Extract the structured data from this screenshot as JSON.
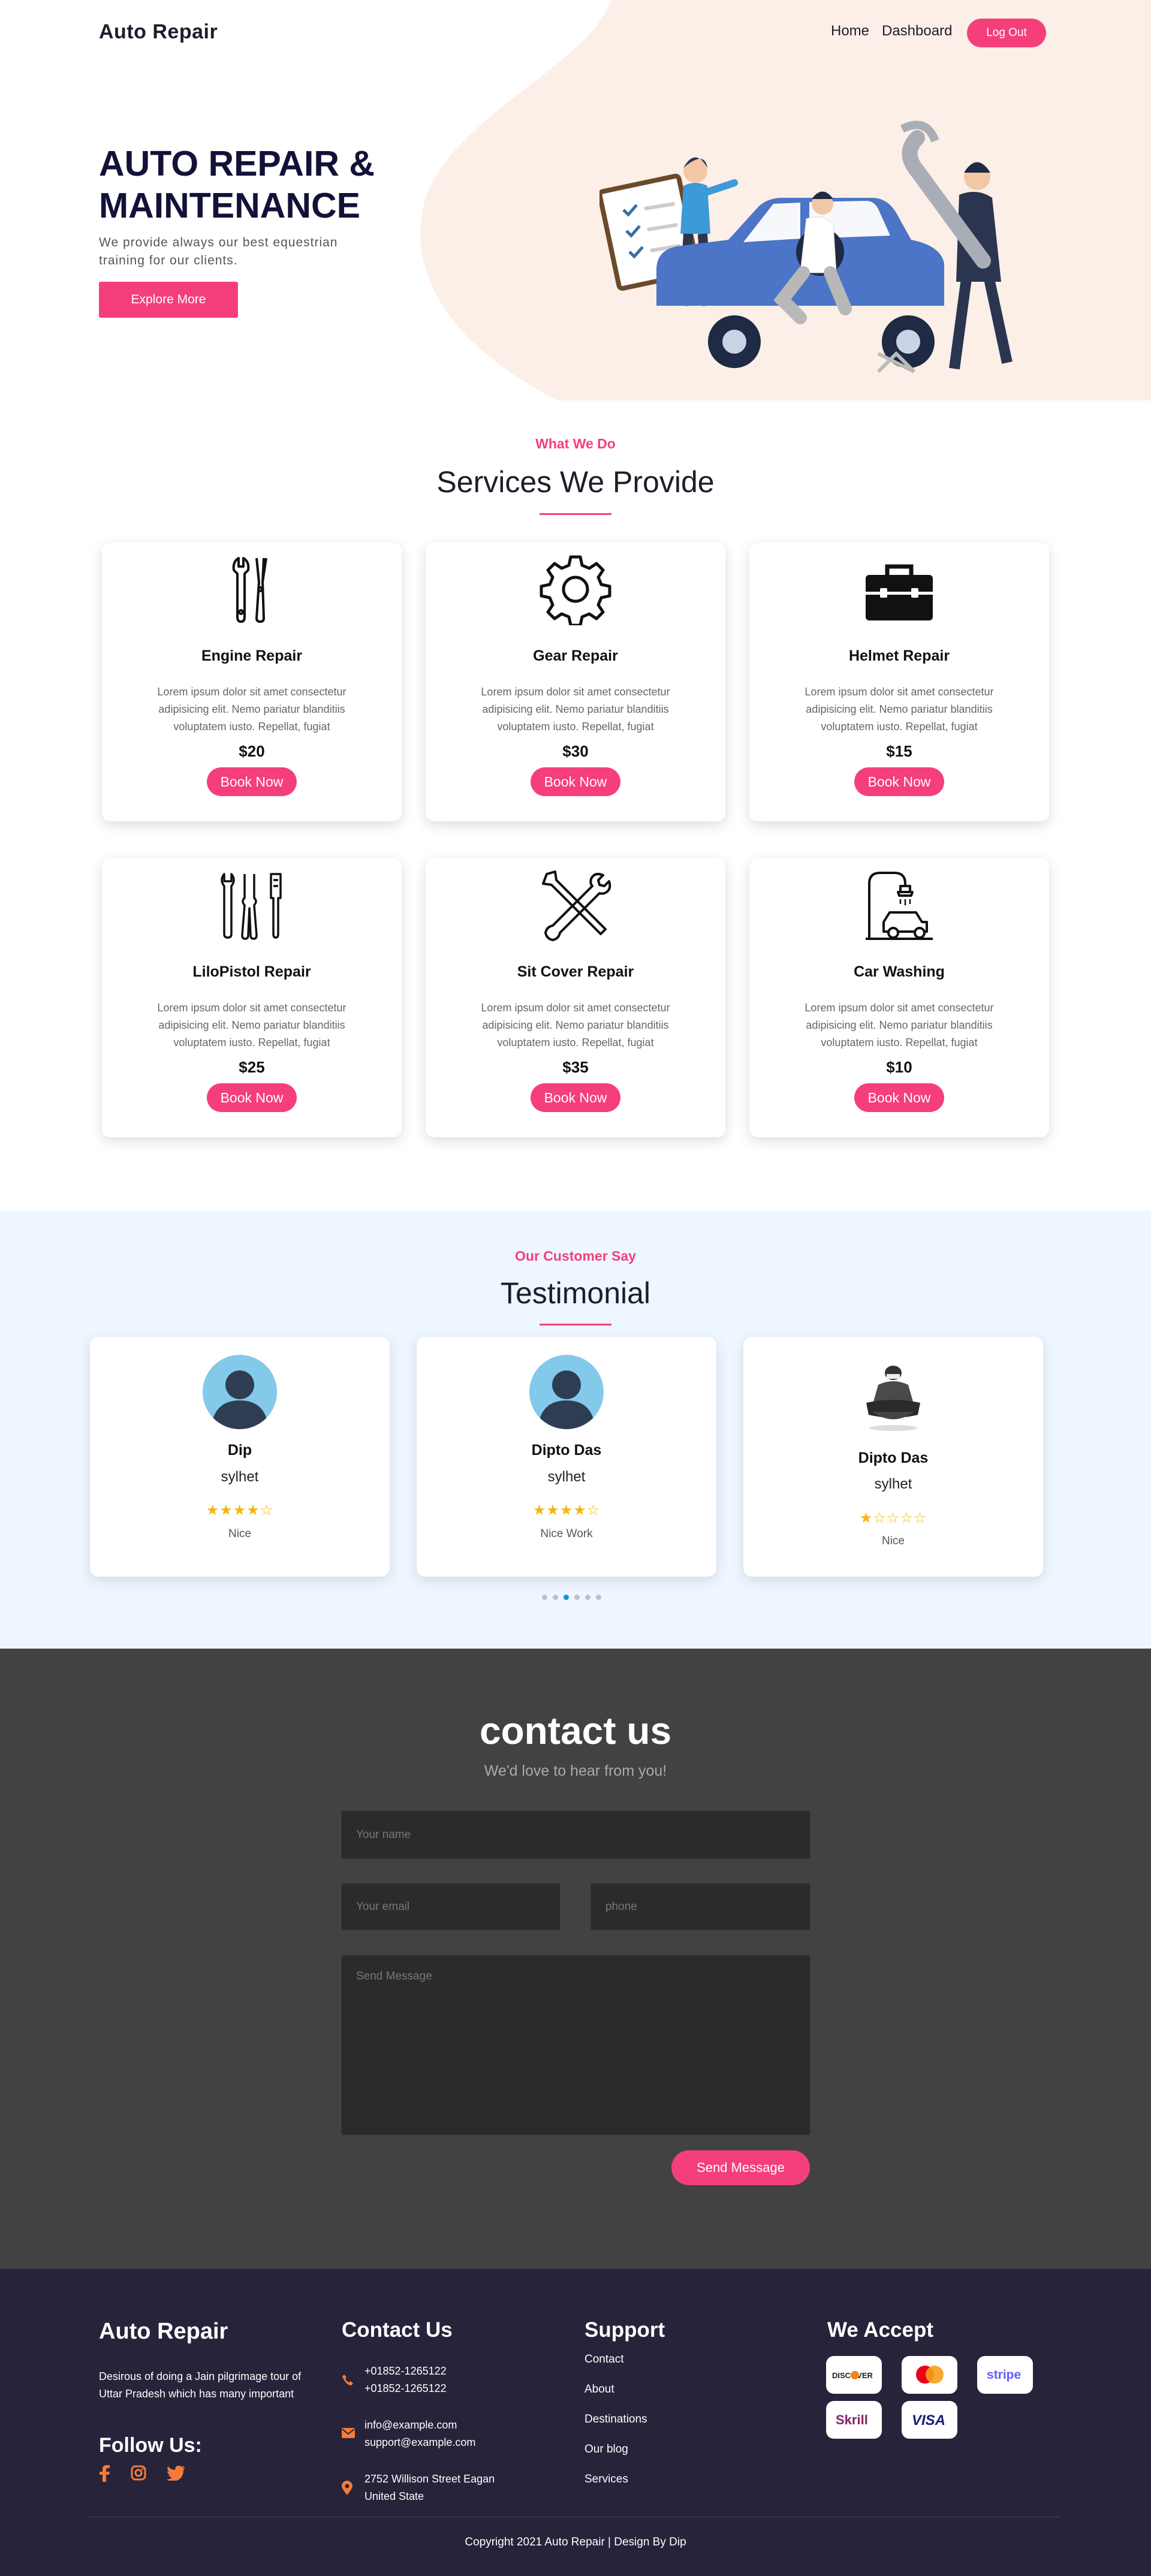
{
  "header": {
    "brand": "Auto Repair",
    "nav": [
      "Home",
      "Dashboard"
    ],
    "logout_label": "Log Out"
  },
  "hero": {
    "title": "AUTO REPAIR & MAINTENANCE",
    "subtitle": "We provide always our best equestrian training for our clients.",
    "cta_label": "Explore More"
  },
  "services": {
    "kicker": "What We Do",
    "title": "Services We Provide",
    "items": [
      {
        "name": "Engine Repair",
        "icon": "wrench-pliers-icon",
        "desc": "Lorem ipsum dolor sit amet consectetur adipisicing elit. Nemo pariatur blanditiis voluptatem iusto. Repellat, fugiat",
        "price": "$20",
        "button": "Book Now"
      },
      {
        "name": "Gear Repair",
        "icon": "gear-icon",
        "desc": "Lorem ipsum dolor sit amet consectetur adipisicing elit. Nemo pariatur blanditiis voluptatem iusto. Repellat, fugiat",
        "price": "$30",
        "button": "Book Now"
      },
      {
        "name": "Helmet Repair",
        "icon": "toolbox-icon",
        "desc": "Lorem ipsum dolor sit amet consectetur adipisicing elit. Nemo pariatur blanditiis voluptatem iusto. Repellat, fugiat",
        "price": "$15",
        "button": "Book Now"
      },
      {
        "name": "LiloPistol Repair",
        "icon": "tool-set-icon",
        "desc": "Lorem ipsum dolor sit amet consectetur adipisicing elit. Nemo pariatur blanditiis voluptatem iusto. Repellat, fugiat",
        "price": "$25",
        "button": "Book Now"
      },
      {
        "name": "Sit Cover Repair",
        "icon": "crossed-tools-icon",
        "desc": "Lorem ipsum dolor sit amet consectetur adipisicing elit. Nemo pariatur blanditiis voluptatem iusto. Repellat, fugiat",
        "price": "$35",
        "button": "Book Now"
      },
      {
        "name": "Car Washing",
        "icon": "car-wash-icon",
        "desc": "Lorem ipsum dolor sit amet consectetur adipisicing elit. Nemo pariatur blanditiis voluptatem iusto. Repellat, fugiat",
        "price": "$10",
        "button": "Book Now"
      }
    ]
  },
  "testimonials": {
    "kicker": "Our Customer Say",
    "title": "Testimonial",
    "items": [
      {
        "name": "Dip",
        "location": "sylhet",
        "rating": 4,
        "stars": "★★★★☆",
        "comment": "Nice",
        "avatar": "user-silhouette"
      },
      {
        "name": "Dipto Das",
        "location": "sylhet",
        "rating": 4,
        "stars": "★★★★☆",
        "comment": "Nice Work",
        "avatar": "user-silhouette"
      },
      {
        "name": "Dipto Das",
        "location": "sylhet",
        "rating": 1,
        "stars": "★☆☆☆☆",
        "comment": "Nice",
        "avatar": "person-photo"
      }
    ],
    "pagination": {
      "count": 6,
      "active": 3
    }
  },
  "contact": {
    "title": "contact us",
    "subtitle": "We'd love to hear from you!",
    "name_placeholder": "Your name",
    "email_placeholder": "Your email",
    "phone_placeholder": "phone",
    "message_placeholder": "Send Message",
    "send_label": "Send Message"
  },
  "footer": {
    "brand": "Auto Repair",
    "description": "Desirous of doing a Jain pilgrimage tour of Uttar Pradesh which has many important",
    "follow_title": "Follow Us:",
    "contact_title": "Contact Us",
    "phone_1": "+01852-1265122",
    "phone_2": "+01852-1265122",
    "email_1": "info@example.com",
    "email_2": "support@example.com",
    "address_1": "2752 Willison Street Eagan",
    "address_2": "United State",
    "support_title": "Support",
    "support_links": [
      "Contact",
      "About",
      "Destinations",
      "Our blog",
      "Services"
    ],
    "accept_title": "We Accept",
    "payments": [
      "DISCOVER",
      "mastercard",
      "stripe",
      "Skrill",
      "VISA"
    ],
    "copyright": "Copyright 2021 Auto Repair | Design By Dip"
  },
  "colors": {
    "accent": "#f43f7a",
    "hero_bg": "#fcefe8",
    "testimonial_bg": "#eef6ff",
    "contact_bg": "#424242",
    "footer_bg": "#26233a",
    "star": "#f5b50a",
    "icon_orange": "#f37b3b"
  }
}
